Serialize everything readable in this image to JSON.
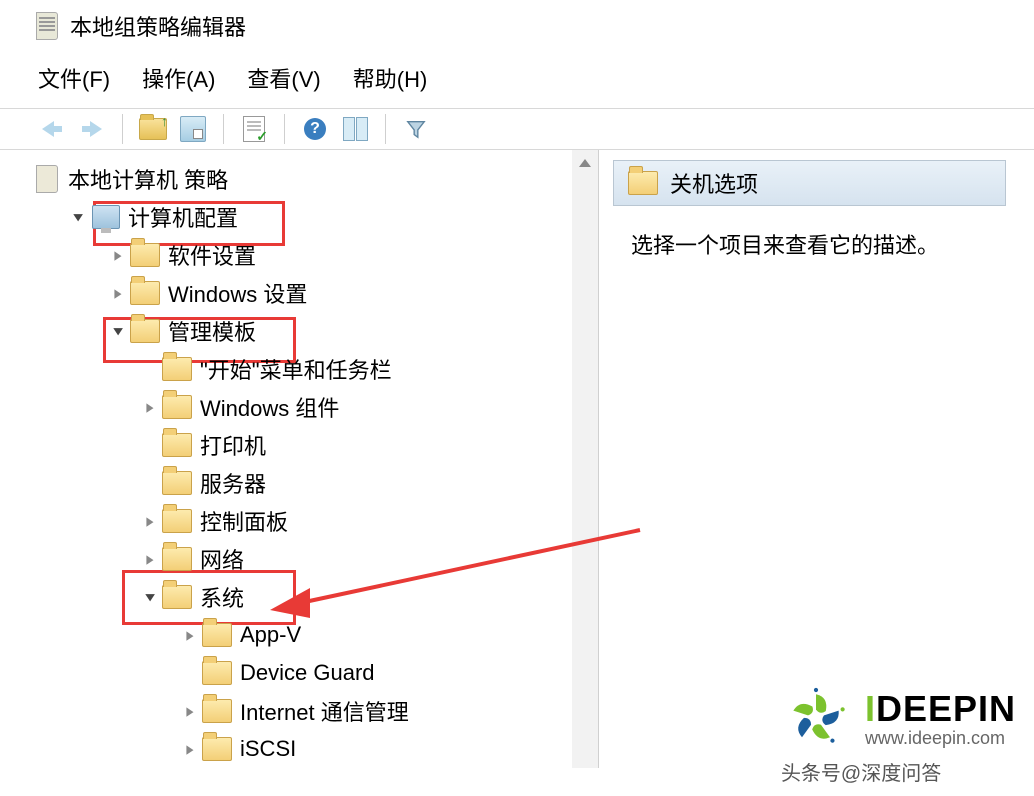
{
  "window": {
    "title": "本地组策略编辑器"
  },
  "menubar": {
    "file": "文件(F)",
    "action": "操作(A)",
    "view": "查看(V)",
    "help": "帮助(H)"
  },
  "toolbar": {
    "back": "back",
    "forward": "forward",
    "up": "up-folder",
    "props": "properties",
    "export": "export-list",
    "help": "?",
    "showhide": "show-hide",
    "filter": "filter"
  },
  "tree": {
    "root_label": "本地计算机 策略",
    "computer_config": "计算机配置",
    "software_settings": "软件设置",
    "windows_settings": "Windows 设置",
    "admin_templates": "管理模板",
    "start_taskbar": "\"开始\"菜单和任务栏",
    "windows_components": "Windows 组件",
    "printers": "打印机",
    "server": "服务器",
    "control_panel": "控制面板",
    "network": "网络",
    "system": "系统",
    "appv": "App-V",
    "device_guard": "Device Guard",
    "internet_comm": "Internet 通信管理",
    "iscsi": "iSCSI"
  },
  "right": {
    "header": "关机选项",
    "description": "选择一个项目来查看它的描述。"
  },
  "watermark": {
    "brand_prefix": "I",
    "brand_rest": "DEEPIN",
    "domain": "www.ideepin.com",
    "credit": "头条号@深度问答"
  }
}
